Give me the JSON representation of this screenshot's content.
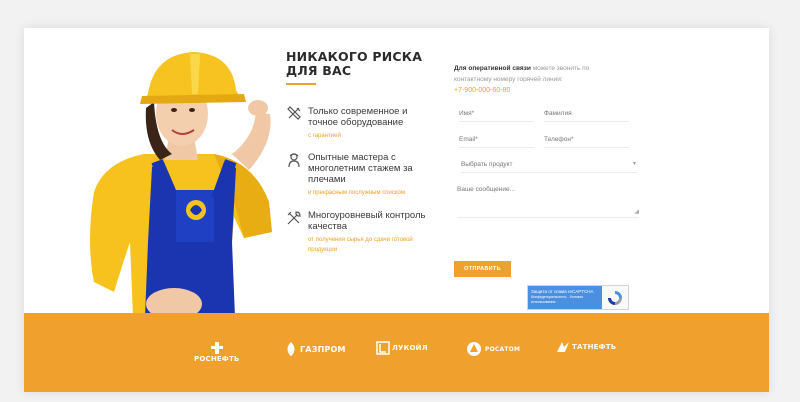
{
  "section": {
    "title_line1": "НИКАКОГО РИСКА",
    "title_line2": "ДЛЯ ВАС"
  },
  "features": [
    {
      "icon": "tools-icon",
      "title_lines": [
        "Только современное и",
        "точное оборудование"
      ],
      "subtitle_lines": [
        "с гарантией"
      ]
    },
    {
      "icon": "worker-icon",
      "title_lines": [
        "Опытные мастера с",
        "многолетним стажем за",
        "плечами"
      ],
      "subtitle_lines": [
        "и прекрасным послужным списком"
      ]
    },
    {
      "icon": "wrench-hammer-icon",
      "title_lines": [
        "Многоуровневый контроль",
        "качества"
      ],
      "subtitle_lines": [
        "от получения сырья до сдачи готовой",
        "продукции"
      ]
    }
  ],
  "contact": {
    "intro_bold": "Для оперативной связи",
    "intro_rest": "можете звонить по",
    "intro_line2": "контактному номеру горячей линии:",
    "phone": "+7-900-000-60-80"
  },
  "form": {
    "name_placeholder": "Имя*",
    "surname_placeholder": "Фамилия",
    "email_placeholder": "Email*",
    "phone_placeholder": "Телефон*",
    "product_select": "Выбрать продукт",
    "message_placeholder": "Ваше сообщение...",
    "submit_label": "ОТПРАВИТЬ"
  },
  "recaptcha": {
    "title": "Защита от спама reCAPTCHA",
    "links_line1": "Конфиденциальность - Условия",
    "links_line2": "использования"
  },
  "partners": [
    {
      "name": "РОСНЕФТЬ",
      "icon": "rosneft-logo-icon"
    },
    {
      "name": "ГАЗПРОМ",
      "icon": "gazprom-logo-icon"
    },
    {
      "name": "ЛУКОЙЛ",
      "icon": "lukoil-logo-icon"
    },
    {
      "name": "РОСАТОМ",
      "icon": "rosatom-logo-icon"
    },
    {
      "name": "ТАТНЕФТЬ",
      "icon": "tatneft-logo-icon"
    }
  ],
  "colors": {
    "accent": "#f0a02c",
    "overall_blue": "#1a3ab0",
    "helmet_yellow": "#f7c320"
  }
}
